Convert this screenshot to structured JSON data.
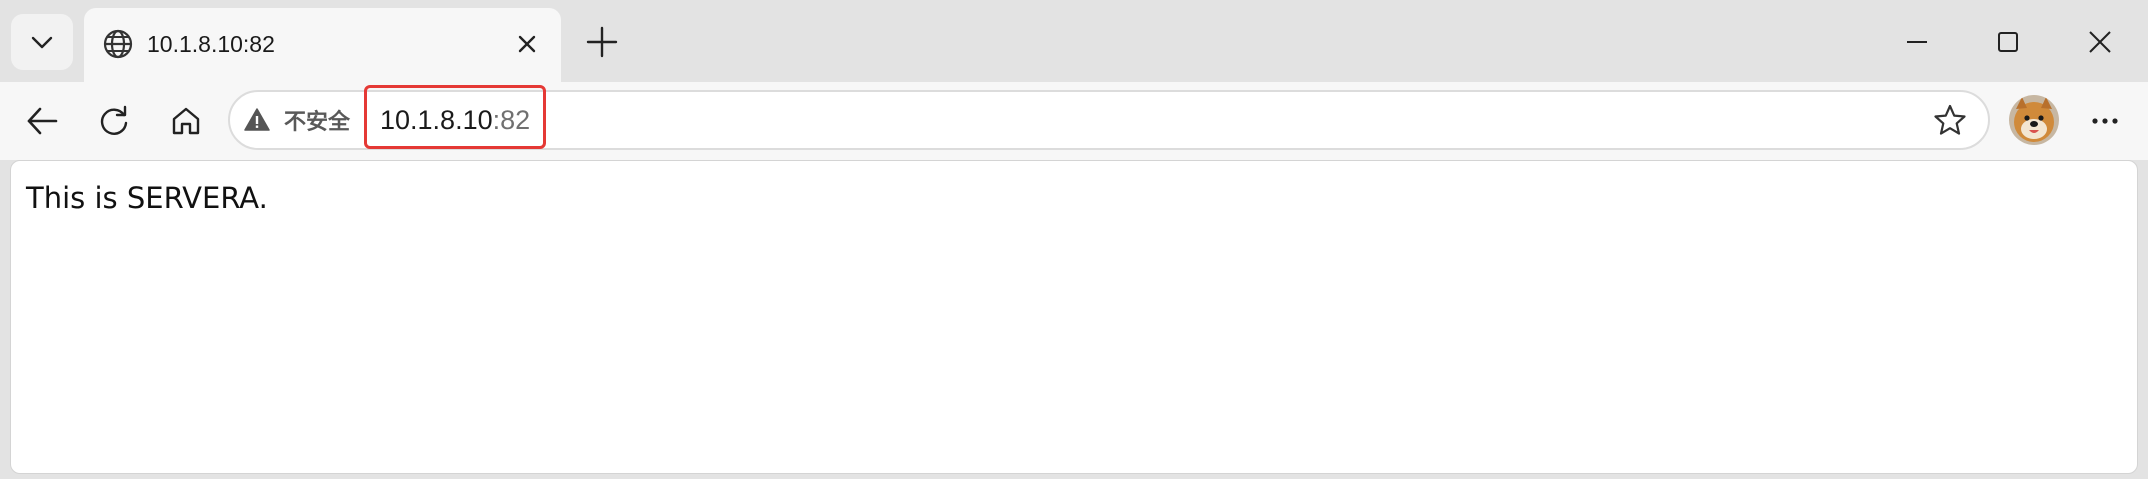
{
  "tab": {
    "title": "10.1.8.10:82"
  },
  "address_bar": {
    "security_label": "不安全",
    "url_host": "10.1.8.10",
    "url_port": ":82"
  },
  "page": {
    "body_text": "This is SERVERA."
  },
  "colors": {
    "highlight_border": "#e53935",
    "toolbar_bg": "#f7f7f7",
    "tabstrip_bg": "#e3e3e3"
  },
  "icons": {
    "tab_menu": "chevron-down-icon",
    "favicon": "globe-icon",
    "tab_close": "close-icon",
    "new_tab": "plus-icon",
    "minimize": "minimize-icon",
    "maximize": "maximize-icon",
    "window_close": "close-icon",
    "back": "arrow-left-icon",
    "reload": "reload-icon",
    "home": "home-icon",
    "security": "warning-icon",
    "favorite": "star-icon",
    "profile": "avatar",
    "more": "more-icon"
  }
}
